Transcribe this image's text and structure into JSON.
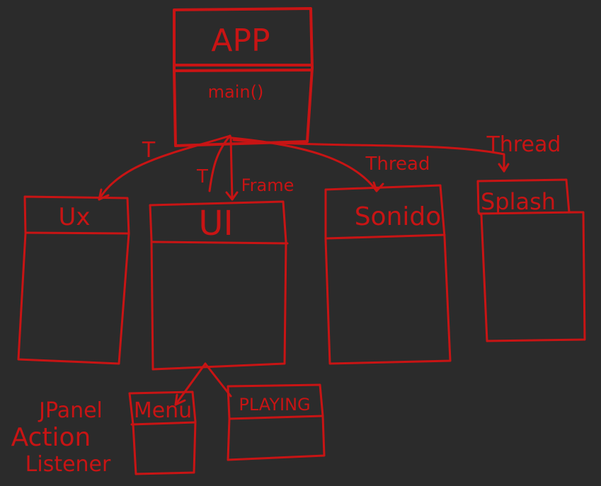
{
  "diagram": {
    "ink_color": "#c81414",
    "background": "#2b2b2b",
    "classes": [
      {
        "id": "app",
        "title": "APP",
        "members": [
          "main()"
        ]
      },
      {
        "id": "ux",
        "title": "Ux",
        "members": []
      },
      {
        "id": "ui",
        "title": "UI",
        "members": []
      },
      {
        "id": "sonido",
        "title": "Sonido",
        "members": []
      },
      {
        "id": "splash",
        "title": "Splash",
        "members": []
      },
      {
        "id": "menu",
        "title": "Menu",
        "members": []
      },
      {
        "id": "playing",
        "title": "PLAYING",
        "members": []
      }
    ],
    "edge_labels": {
      "app_ux": "T",
      "app_ui_t": "T",
      "app_ui_frame": "Frame",
      "app_sonido": "Thread",
      "app_splash": "Thread"
    },
    "menu_note": [
      "JPanel",
      "Action",
      "Listener"
    ]
  }
}
